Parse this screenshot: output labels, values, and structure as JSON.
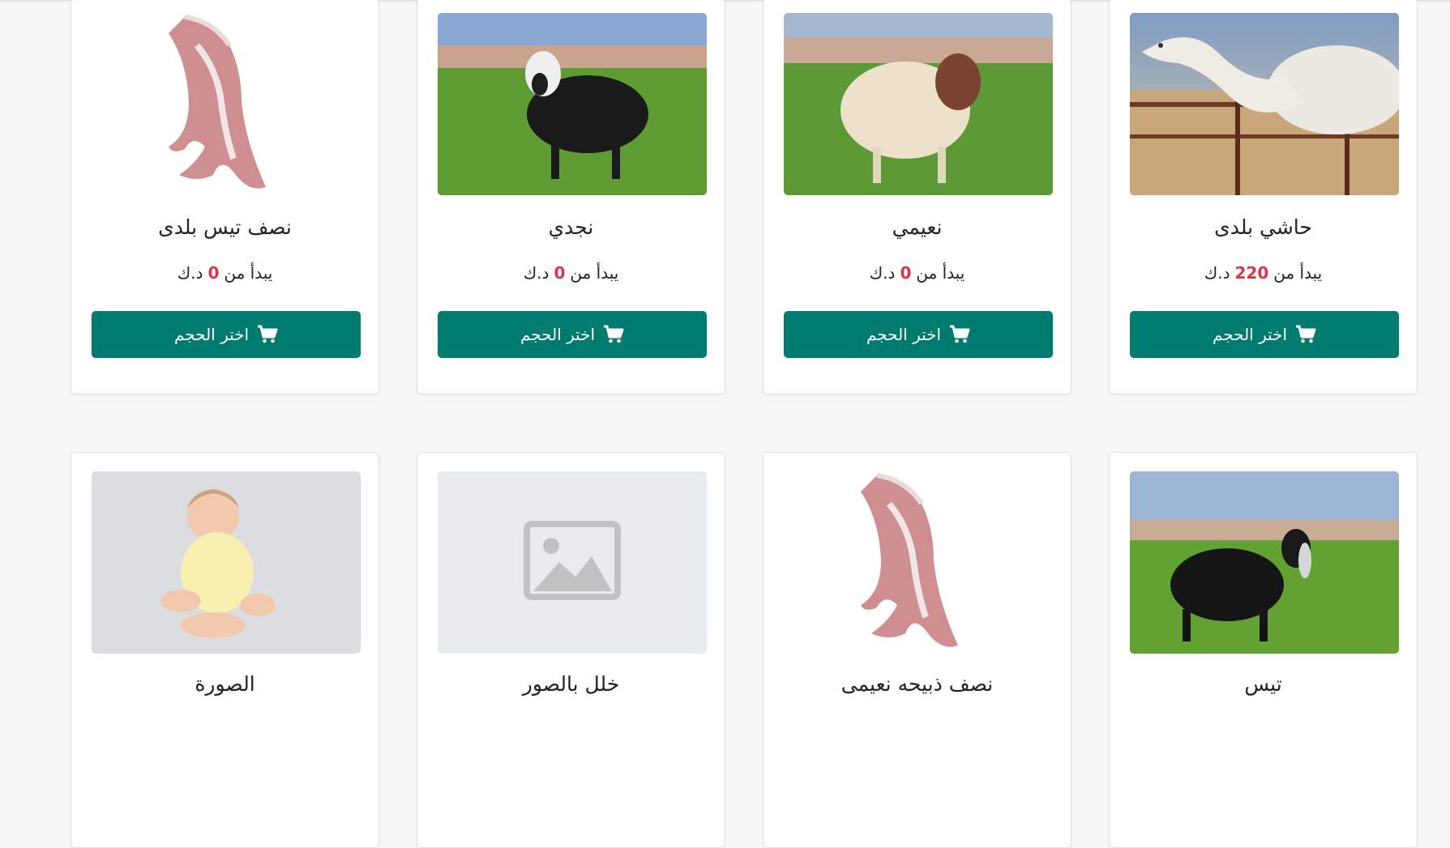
{
  "colors": {
    "button_bg": "#007b70",
    "price_accent": "#dc3545",
    "page_bg": "#f8f8f8"
  },
  "products": [
    {
      "title": "حاشي بلدى",
      "price_prefix": "يبدأ من",
      "price": "220",
      "currency": "د.ك",
      "button_label": "اختر الحجم",
      "button_icon": "cart-icon",
      "image": "camel-photo"
    },
    {
      "title": "نعيمي",
      "price_prefix": "يبدأ من",
      "price": "0",
      "currency": "د.ك",
      "button_label": "اختر الحجم",
      "button_icon": "cart-icon",
      "image": "white-sheep-photo"
    },
    {
      "title": "نجدي",
      "price_prefix": "يبدأ من",
      "price": "0",
      "currency": "د.ك",
      "button_label": "اختر الحجم",
      "button_icon": "cart-icon",
      "image": "black-sheep-photo"
    },
    {
      "title": "نصف تيس بلدى",
      "price_prefix": "يبدأ من",
      "price": "0",
      "currency": "د.ك",
      "button_label": "اختر الحجم",
      "button_icon": "cart-icon",
      "image": "meat-carcass-photo"
    },
    {
      "title": "تيس",
      "image": "black-goat-photo"
    },
    {
      "title": "نصف ذبيحه نعيمى",
      "image": "meat-carcass-photo"
    },
    {
      "title": "خلل بالصور",
      "image": "image-placeholder-icon"
    },
    {
      "title": "الصورة",
      "image": "baby-photo"
    }
  ]
}
